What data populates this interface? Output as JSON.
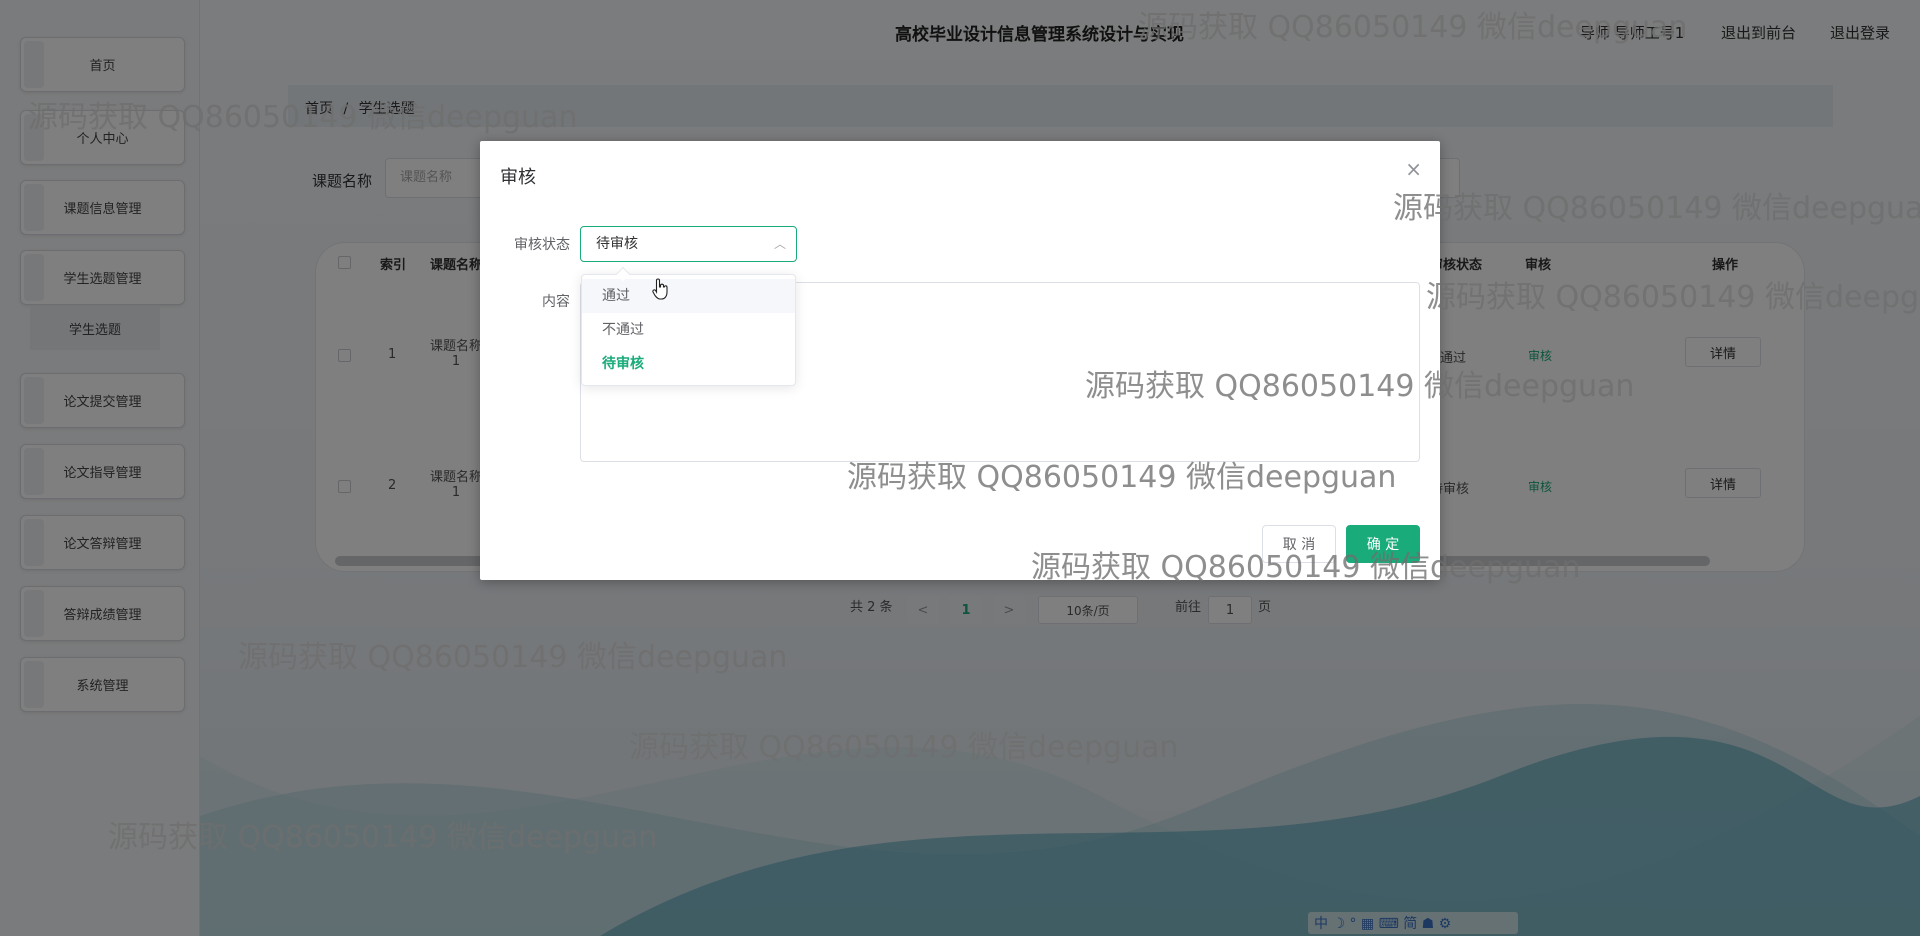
{
  "site_title": "高校毕业设计信息管理系统设计与实现",
  "header": {
    "user_label": "导师 导师工号1",
    "front_link": "退出到前台",
    "logout_link": "退出登录"
  },
  "sidebar": {
    "items": [
      {
        "label": "首页"
      },
      {
        "label": "个人中心"
      },
      {
        "label": "课题信息管理"
      },
      {
        "label": "学生选题管理"
      },
      {
        "label": "论文提交管理"
      },
      {
        "label": "论文指导管理"
      },
      {
        "label": "论文答辩管理"
      },
      {
        "label": "答辩成绩管理"
      },
      {
        "label": "系统管理"
      }
    ],
    "subitem": "学生选题"
  },
  "breadcrumb": {
    "home": "首页",
    "sep": "/",
    "current": "学生选题"
  },
  "search": {
    "label": "课题名称",
    "placeholder": "课题名称"
  },
  "table": {
    "headers": [
      "索引",
      "课题名称",
      "审核状态",
      "审核",
      "操作"
    ],
    "rows": [
      {
        "index": "1",
        "name_line1": "课题名称",
        "name_line2": "1",
        "status": "通过",
        "audit": "审核",
        "action": "详情"
      },
      {
        "index": "2",
        "name_line1": "课题名称",
        "name_line2": "1",
        "status": "待审核",
        "audit": "审核",
        "action": "详情"
      }
    ]
  },
  "pagination": {
    "total": "共 2 条",
    "prev": "<",
    "page": "1",
    "next": ">",
    "size": "10条/页",
    "goto_label": "前往",
    "goto_value": "1",
    "goto_suffix": "页"
  },
  "dialog": {
    "title": "审核",
    "close": "×",
    "status_label": "审核状态",
    "status_value": "待审核",
    "content_label": "内容",
    "cancel": "取 消",
    "confirm": "确 定",
    "options": [
      "通过",
      "不通过",
      "待审核"
    ]
  },
  "watermark": "源码获取 QQ86050149 微信deepguan",
  "ime": "中 ☽ ° ▦ ⌨ 简 ☗ ⚙",
  "colors": {
    "accent": "#1aab7a",
    "mask": "rgba(0,0,0,0.5)"
  }
}
